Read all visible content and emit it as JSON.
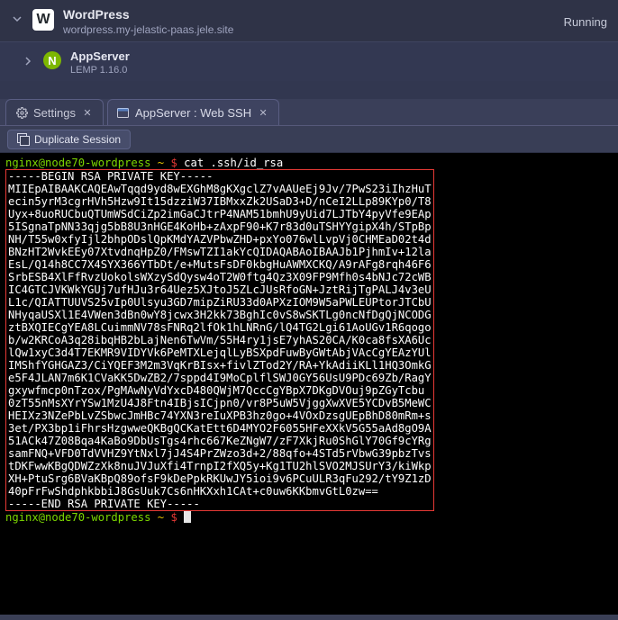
{
  "env": {
    "title": "WordPress",
    "hostname": "wordpress.my-jelastic-paas.jele.site",
    "status": "Running",
    "icon_letter": "W"
  },
  "node": {
    "title": "AppServer",
    "subtitle": "LEMP 1.16.0",
    "icon_letter": "N"
  },
  "tabs": {
    "settings": "Settings",
    "webssh": "AppServer : Web SSH"
  },
  "toolbar": {
    "duplicate": "Duplicate Session"
  },
  "terminal": {
    "prompt_user": "nginx@node70-wordpress",
    "prompt_sep": " ~ $ ",
    "command": "cat .ssh/id_rsa",
    "key_lines": [
      "-----BEGIN RSA PRIVATE KEY-----",
      "MIIEpAIBAAKCAQEAwTqqd9yd8wEXGhM8gKXgclZ7vAAUeEj9Jv/7PwS23iIhzHuT",
      "ecin5yrM3cgrHVh5Hzw9It15dzziW37IBMxxZk2USaD3+D/nCeI2LLp89KYp0/T8",
      "Uyx+8uoRUCbuQTUmWSdCiZp2imGaCJtrP4NAM51bmhU9yUid7LJTbY4pyVfe9EAp",
      "5ISgnaTpNN33qjg5bB8U3nHGE4KoHb+zAxpF90+K7r83d0uTSHYYgipX4h/STpBp",
      "NH/T55w0xfyIjl2bhpODslQpKMdYAZVPbwZHD+pxYo076wlLvpVj0CHMEaD02t4d",
      "BNzHT2WvkEEy07XtvdnqHpZ0/FMswTZI1akYcQIDAQABAoIBAAJb1PjhmIv+12la",
      "EsL/Q14h8CC7X4SYX366YTbDt/e+MutsFsDF0kbgHuAWMXCKQ/A9rAFg8rqh46F6",
      "SrbESB4XlFfRvzUokolsWXzySdQysw4oT2W0ftg4Qz3X09FP9Mfh0s4bNJc72cWB",
      "IC4GTCJVKWkYGUj7ufHJu3r64Uez5XJtoJ5ZLcJUsRfoGN+JztRijTgPALJ4v3eU",
      "L1c/QIATTUUVS25vIp0Ulsyu3GD7mipZiRU33d0APXzIOM9W5aPWLEUPtorJTCbU",
      "NHyqaUSXl1E4VWen3dBn0wY8jcwx3H2kk73BghIc0vS8wSKTLg0ncNfDgQjNCODG",
      "ztBXQIECgYEA8LCuimmNV78sFNRq2lfOk1hLNRnG/lQ4TG2Lgi61AoUGv1R6qogo",
      "b/w2KRCoA3q28ibqHB2bLajNen6TwVm/S5H4ry1jsE7yhAS20CA/K0ca8fsXA6Uc",
      "lQw1xyC3d4T7EKMR9VIDYVk6PeMTXLejqlLyBSXpdFuwByGWtAbjVAcCgYEAzYUl",
      "IMShfYGHGAZ3/CiYQEF3M2m3VqKrBIsx+fivlZTod2Y/RA+YkAdiiKLl1HQ3OmkG",
      "e5F4JLAN7m6K1CVaKK5DwZB2/7sppd4I9MoCplflSWJ0GY56UsU9PDc69Zb/RagY",
      "gxywfmcp0nTzox/PgMAwNyVdYxcD480QWjM7QccCgYBpX7DKgDVOuj9pZGyTcbu",
      "0zT55nMsXYrYSw1MzU4J8Ftn4IBjsICjpn0/vr8P5uW5VjggXwXVE5YCDvB5MeWC",
      "HEIXz3NZePbLvZSbwcJmHBc74YXN3reIuXPB3hz0go+4VOxDzsgUEpBhD80mRm+s",
      "3et/PX3bp1iFhrsHzgwweQKBgQCKatEtt6D4MYO2F6055HFeXXkV5G55aAd8gO9A",
      "51ACk47Z08Bqa4KaBo9DbUsTgs4rhc667KeZNgW7/zF7XkjRu0ShGlY70Gf9cYRg",
      "samFNQ+VFD0TdVVHZ9YtNxl7jJ4S4PrZWzo3d+2/88qfo+4STd5rVbwG39pbzTvs",
      "tDKFwwKBgQDWZzXk8nuJVJuXfi4TrnpI2fXQ5y+Kg1TU2hlSVO2MJSUrY3/kiWkp",
      "XH+PtuSrg6BVaKBpQ89ofsF9kDePpkRKUwJY5ioi9v6PCuULR3qFu292/tY9Z1zD",
      "40pFrFwShdphkbbiJ8GsUuk7Cs6nHKXxh1CAt+c0uw6KKbmvGtL0zw==",
      "-----END RSA PRIVATE KEY-----"
    ]
  }
}
